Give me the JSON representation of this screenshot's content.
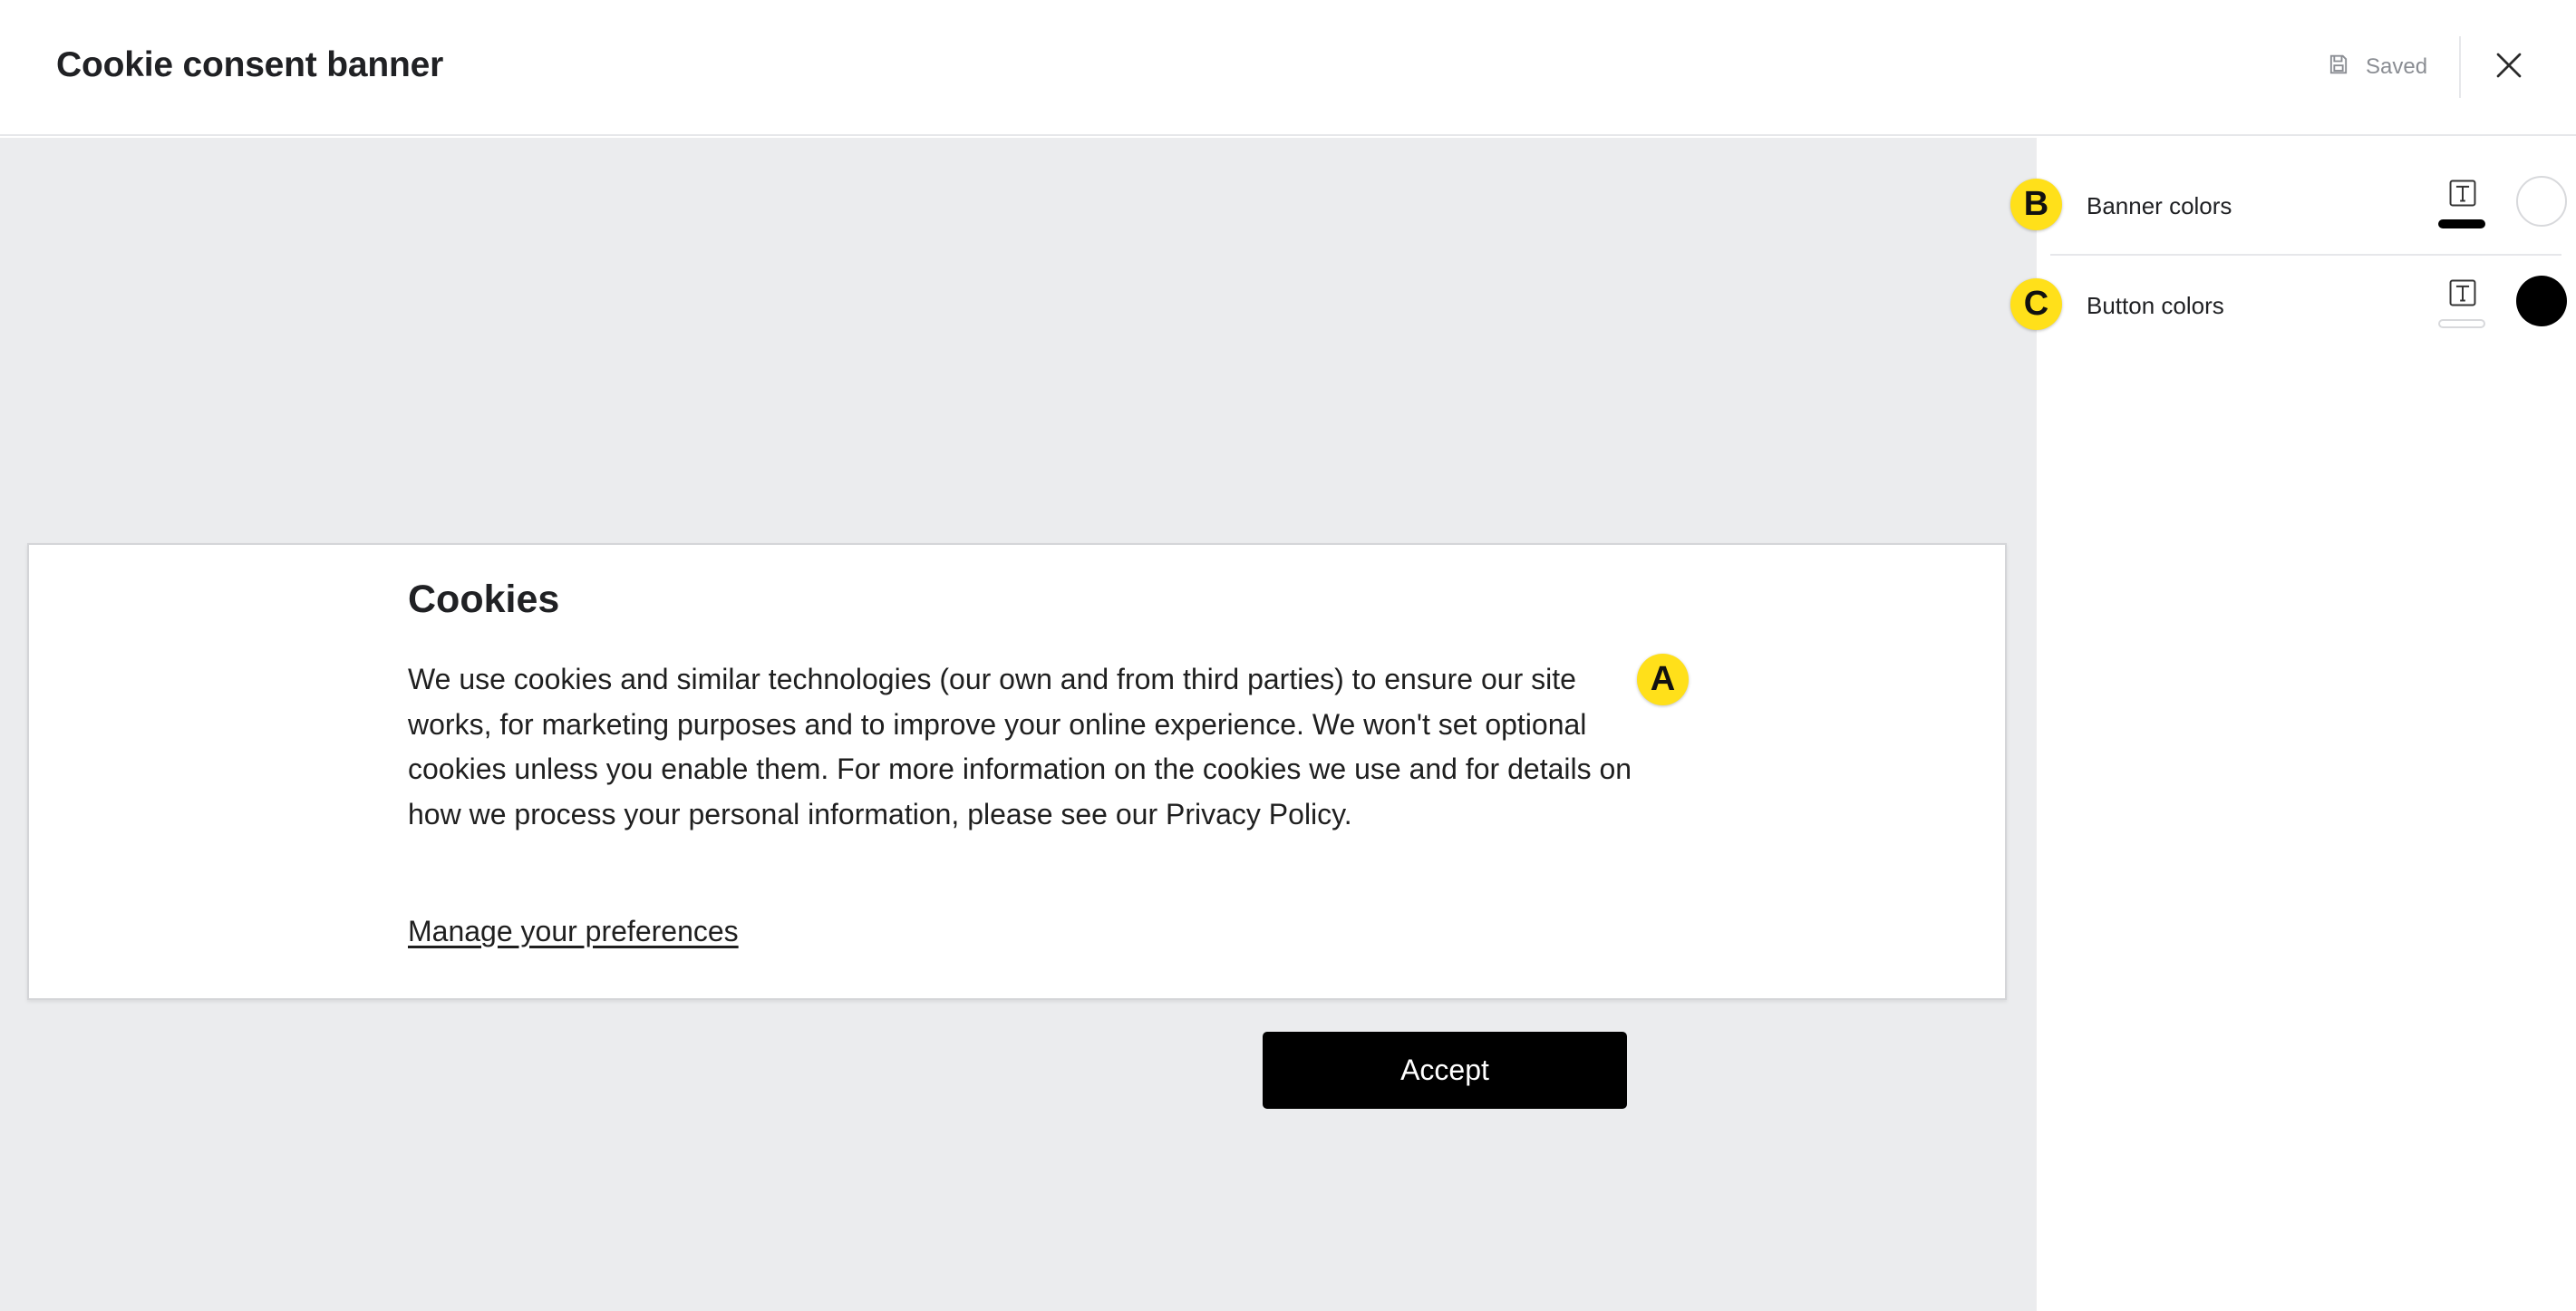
{
  "header": {
    "title": "Cookie consent banner",
    "saved_label": "Saved",
    "saved_icon": "save-icon",
    "close_icon": "close-icon"
  },
  "banner": {
    "title": "Cookies",
    "body": "We use cookies and similar technologies (our own and from third parties) to ensure our site works, for marketing purposes and to improve your online experience. We won't set optional cookies unless you enable them. For more information on the cookies we use and for details on how we process your personal information, please see our Privacy Policy.",
    "manage_label": "Manage your preferences",
    "accept_label": "Accept"
  },
  "callouts": {
    "a": "A",
    "b": "B",
    "c": "C"
  },
  "panel": {
    "rows": [
      {
        "label": "Banner colors",
        "text_color": "#000000",
        "background_color": "#ffffff",
        "text_icon": "text-format-icon"
      },
      {
        "label": "Button colors",
        "text_color": "#ffffff",
        "background_color": "#000000",
        "text_icon": "text-format-icon"
      }
    ]
  },
  "colors": {
    "canvas_bg": "#ebecee",
    "badge": "#ffe01a",
    "accept_bg": "#000000"
  }
}
